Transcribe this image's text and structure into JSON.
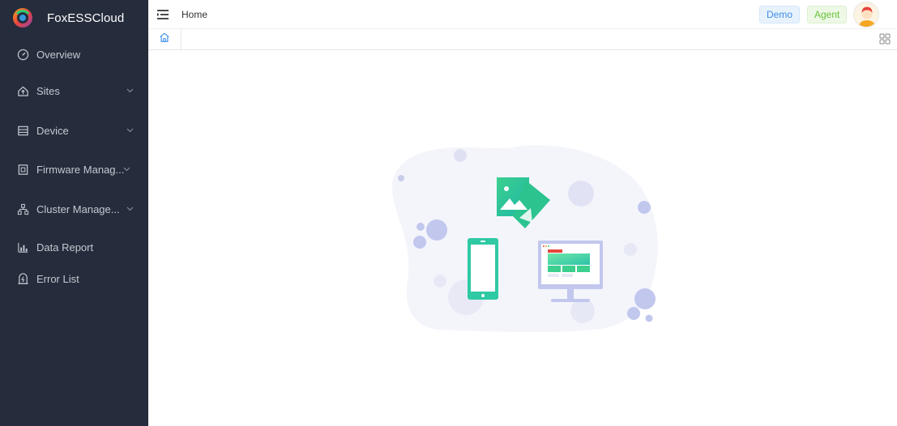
{
  "app": {
    "brand_name": "FoxESSCloud",
    "colors": {
      "sidebar_bg": "#252c3b",
      "sidebar_text": "#c4c9d2",
      "accent_blue": "#3f8fe8",
      "accent_green": "#67c23a"
    }
  },
  "sidebar": {
    "items": [
      {
        "label": "Overview",
        "icon": "dashboard-icon",
        "has_children": false
      },
      {
        "label": "Sites",
        "icon": "home-upload-icon",
        "has_children": true
      },
      {
        "label": "Device",
        "icon": "device-list-icon",
        "has_children": true
      },
      {
        "label": "Firmware Manag...",
        "icon": "firmware-icon",
        "has_children": true
      },
      {
        "label": "Cluster Manage...",
        "icon": "cluster-icon",
        "has_children": true
      },
      {
        "label": "Data Report",
        "icon": "bar-chart-icon",
        "has_children": false
      },
      {
        "label": "Error List",
        "icon": "error-list-icon",
        "has_children": false
      }
    ]
  },
  "header": {
    "breadcrumb": "Home",
    "tags": {
      "demo": "Demo",
      "agent": "Agent"
    },
    "menu_icon": "hamburger-icon",
    "avatar_icon": "user-avatar"
  },
  "tabs": {
    "home_icon": "home-icon",
    "grid_icon": "grid-icon"
  },
  "main": {
    "illustration": "empty-devices-illustration"
  }
}
